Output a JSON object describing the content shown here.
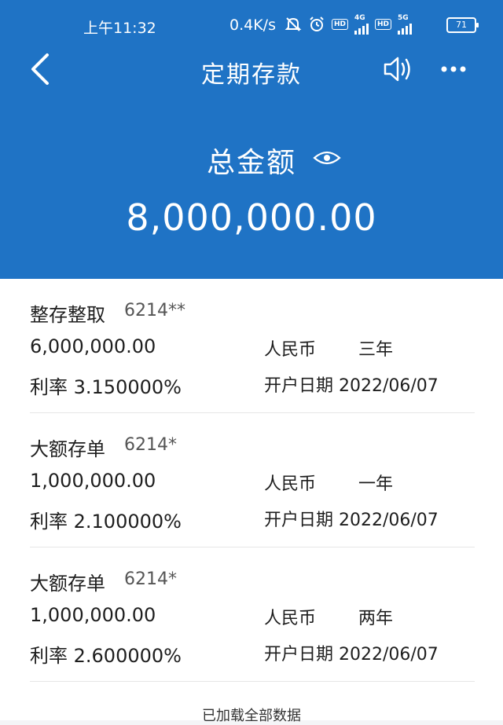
{
  "status_bar": {
    "time": "上午11:32",
    "net_speed": "0.4K/s",
    "battery": "71",
    "hd_label": "HD",
    "net_4g": "4G",
    "net_5g": "5G"
  },
  "nav": {
    "title": "定期存款"
  },
  "summary": {
    "total_label": "总金额",
    "total_amount": "8,000,000.00"
  },
  "deposits": [
    {
      "type": "整存整取",
      "account": "6214**",
      "amount": "6,000,000.00",
      "rate": "利率 3.150000%",
      "currency": "人民币",
      "term": "三年",
      "open_date": "开户日期 2022/06/07"
    },
    {
      "type": "大额存单",
      "account": "6214*",
      "amount": "1,000,000.00",
      "rate": "利率 2.100000%",
      "currency": "人民币",
      "term": "一年",
      "open_date": "开户日期 2022/06/07"
    },
    {
      "type": "大额存单",
      "account": "6214*",
      "amount": "1,000,000.00",
      "rate": "利率 2.600000%",
      "currency": "人民币",
      "term": "两年",
      "open_date": "开户日期 2022/06/07"
    }
  ],
  "footer": {
    "loaded_text": "已加载全部数据"
  },
  "colors": {
    "header_bg": "#1f73c5",
    "text": "#1e1e1e"
  }
}
